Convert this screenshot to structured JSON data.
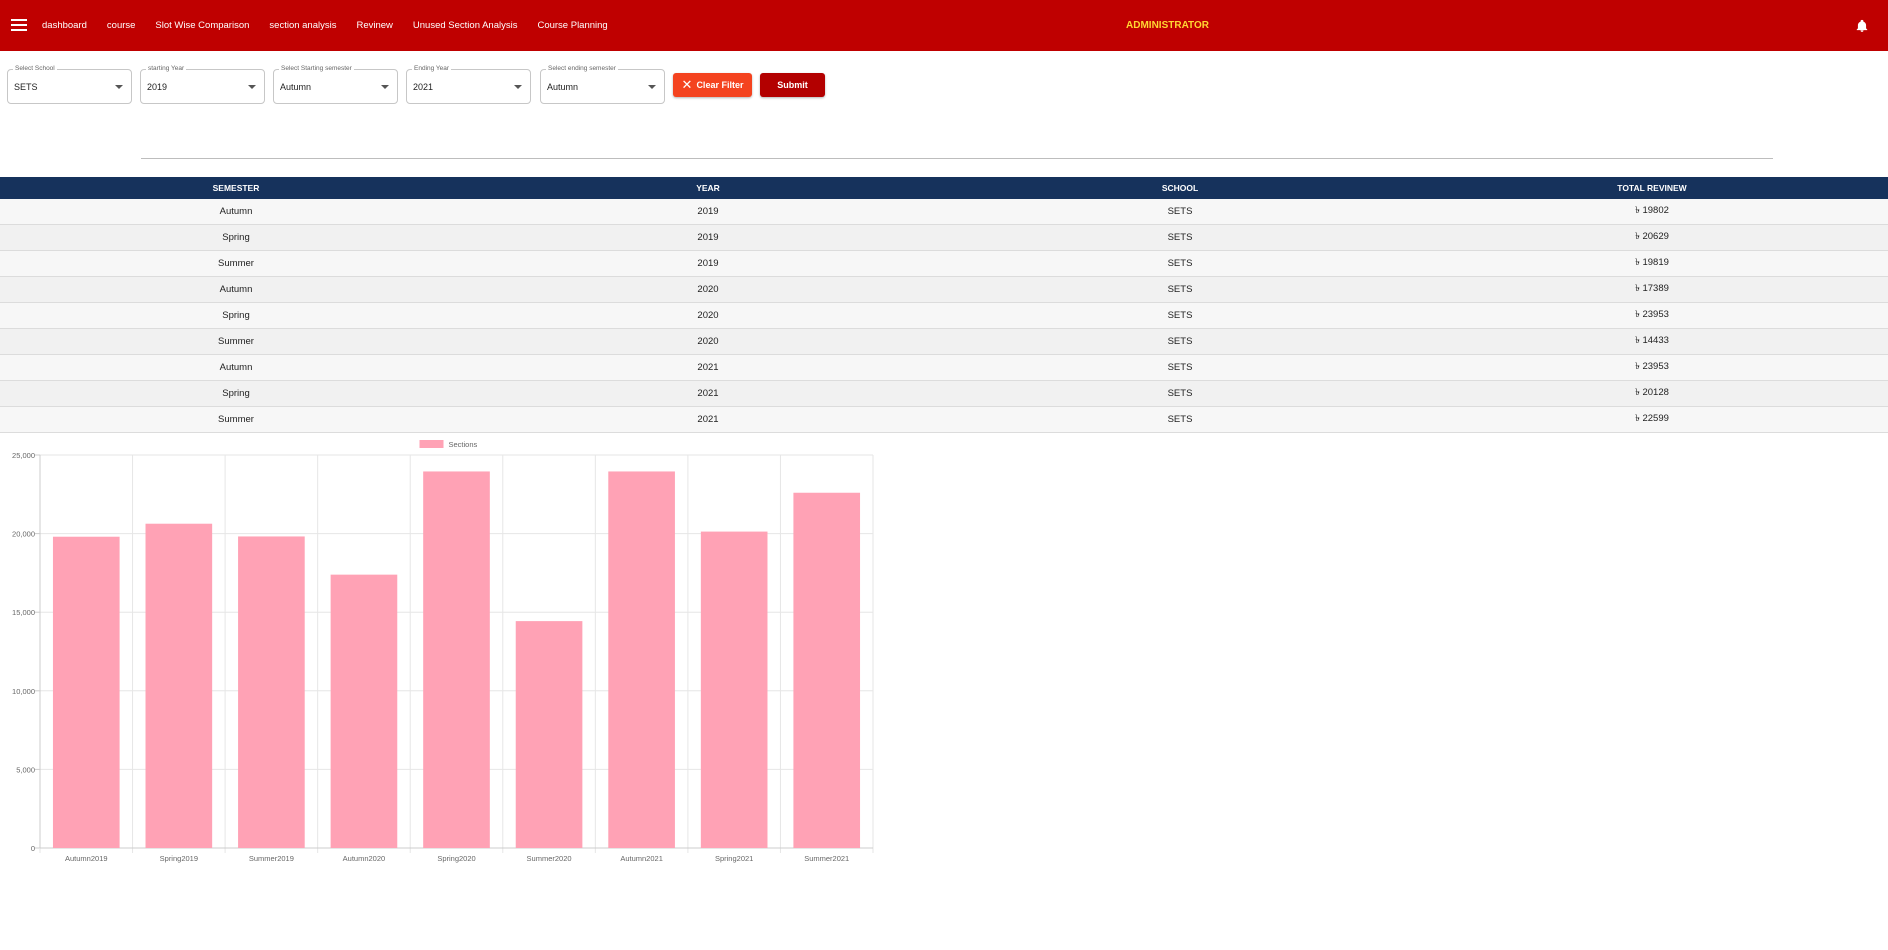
{
  "header": {
    "nav": [
      "dashboard",
      "course",
      "Slot Wise Comparison",
      "section analysis",
      "Revinew",
      "Unused Section Analysis",
      "Course Planning"
    ],
    "role": "ADMINISTRATOR",
    "bar_color": "#bf0000",
    "role_color": "#ffd633"
  },
  "filters": [
    {
      "label": "Select School",
      "value": "SETS"
    },
    {
      "label": "starting Year",
      "value": "2019"
    },
    {
      "label": "Select Starting semester",
      "value": "Autumn"
    },
    {
      "label": "Ending Year",
      "value": "2021"
    },
    {
      "label": "Select ending semester",
      "value": "Autumn"
    }
  ],
  "buttons": {
    "clear": "Clear Filter",
    "submit": "Submit"
  },
  "table": {
    "headers": [
      "SEMESTER",
      "YEAR",
      "SCHOOL",
      "TOTAL REVINEW"
    ],
    "rows": [
      [
        "Autumn",
        "2019",
        "SETS",
        "৳ 19802"
      ],
      [
        "Spring",
        "2019",
        "SETS",
        "৳ 20629"
      ],
      [
        "Summer",
        "2019",
        "SETS",
        "৳ 19819"
      ],
      [
        "Autumn",
        "2020",
        "SETS",
        "৳ 17389"
      ],
      [
        "Spring",
        "2020",
        "SETS",
        "৳ 23953"
      ],
      [
        "Summer",
        "2020",
        "SETS",
        "৳ 14433"
      ],
      [
        "Autumn",
        "2021",
        "SETS",
        "৳ 23953"
      ],
      [
        "Spring",
        "2021",
        "SETS",
        "৳ 20128"
      ],
      [
        "Summer",
        "2021",
        "SETS",
        "৳ 22599"
      ]
    ],
    "header_color": "#16325c"
  },
  "chart_data": {
    "type": "bar",
    "categories": [
      "Autumn2019",
      "Spring2019",
      "Summer2019",
      "Autumn2020",
      "Spring2020",
      "Summer2020",
      "Autumn2021",
      "Spring2021",
      "Summer2021"
    ],
    "series": [
      {
        "name": "Sections",
        "values": [
          19802,
          20629,
          19819,
          17389,
          23953,
          14433,
          23953,
          20128,
          22599
        ]
      }
    ],
    "ylim": [
      0,
      25000
    ],
    "yticks": [
      "0",
      "5,000",
      "10,000",
      "15,000",
      "20,000",
      "25,000"
    ],
    "legend": "top",
    "grid": true,
    "color": "#ffa2b5"
  }
}
